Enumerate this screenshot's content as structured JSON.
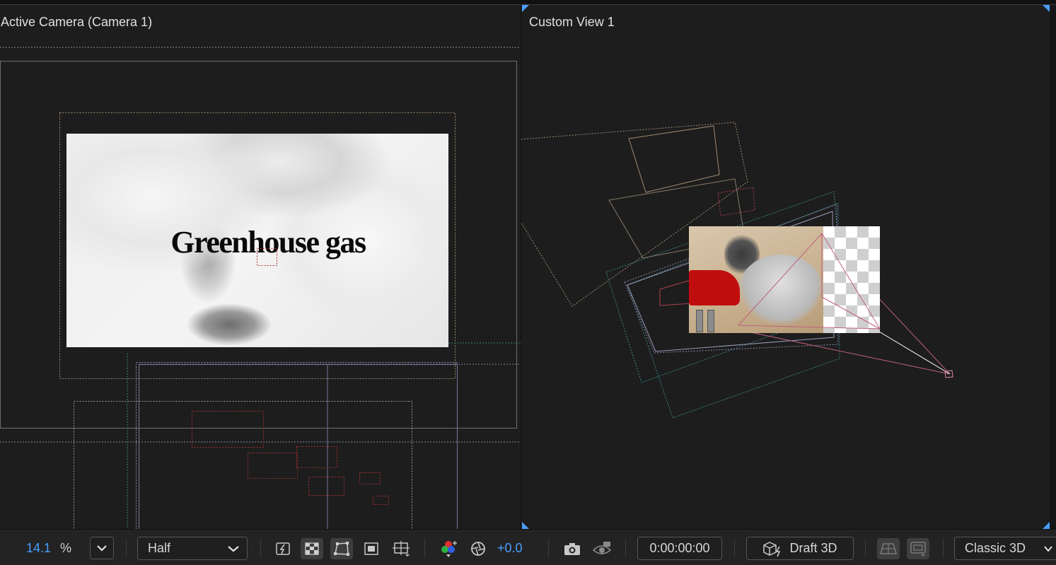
{
  "viewer": {
    "left_panel": {
      "title": "Active Camera (Camera 1)"
    },
    "right_panel": {
      "title": "Custom View 1"
    },
    "composition_text": "Greenhouse gas"
  },
  "toolbar": {
    "zoom_value": "14.1",
    "zoom_unit": "%",
    "resolution": "Half",
    "exposure": "+0.0",
    "timecode": "0:00:00:00",
    "draft_3d_label": "Draft 3D",
    "renderer": "Classic 3D",
    "icons": [
      "zoom-dropdown-icon",
      "fast-previews-icon",
      "transparency-grid-icon",
      "mask-path-visibility-icon",
      "region-of-interest-icon",
      "guides-options-icon",
      "show-channel-icon",
      "reset-exposure-icon",
      "snapshot-icon",
      "show-snapshot-icon",
      "3d-ground-plane-icon",
      "extended-viewer-icon"
    ]
  },
  "colors": {
    "accent": "#4a9eff",
    "background": "#1d1d1d",
    "toolbar": "#232323"
  }
}
